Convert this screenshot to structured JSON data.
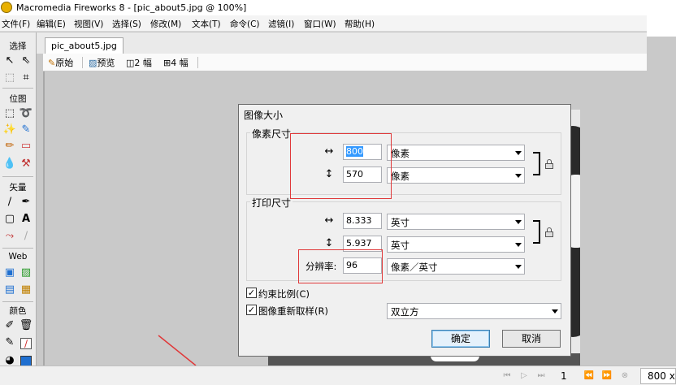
{
  "window": {
    "title": "Macromedia Fireworks 8 - [pic_about5.jpg @ 100%]"
  },
  "menubar": {
    "items": [
      "文件(F)",
      "编辑(E)",
      "视图(V)",
      "选择(S)",
      "修改(M)",
      "文本(T)",
      "命令(C)",
      "滤镜(I)",
      "窗口(W)",
      "帮助(H)"
    ]
  },
  "toolbox": {
    "sections": [
      "选择",
      "位图",
      "矢量",
      "Web",
      "颜色"
    ],
    "stroke_color": "#1f6fd0"
  },
  "document": {
    "tab": "pic_about5.jpg",
    "views": {
      "original": "原始",
      "preview": "预览",
      "two_up": "2 幅",
      "four_up": "4 幅"
    }
  },
  "dialog": {
    "title": "图像大小",
    "pixel_group": "像素尺寸",
    "pixel_width": "800",
    "pixel_height": "570",
    "pixel_unit_w": "像素",
    "pixel_unit_h": "像素",
    "print_group": "打印尺寸",
    "print_width": "8.333",
    "print_height": "5.937",
    "print_unit_w": "英寸",
    "print_unit_h": "英寸",
    "resolution_label": "分辨率:",
    "resolution": "96",
    "resolution_unit": "像素／英寸",
    "constrain_label": "约束比例(C)",
    "constrain_checked": true,
    "resample_label": "图像重新取样(R)",
    "resample_checked": true,
    "resample_method": "双立方",
    "ok_label": "确定",
    "cancel_label": "取消",
    "highlight_color": "#e0393a"
  },
  "status": {
    "frame": "1",
    "size": "800 x"
  }
}
